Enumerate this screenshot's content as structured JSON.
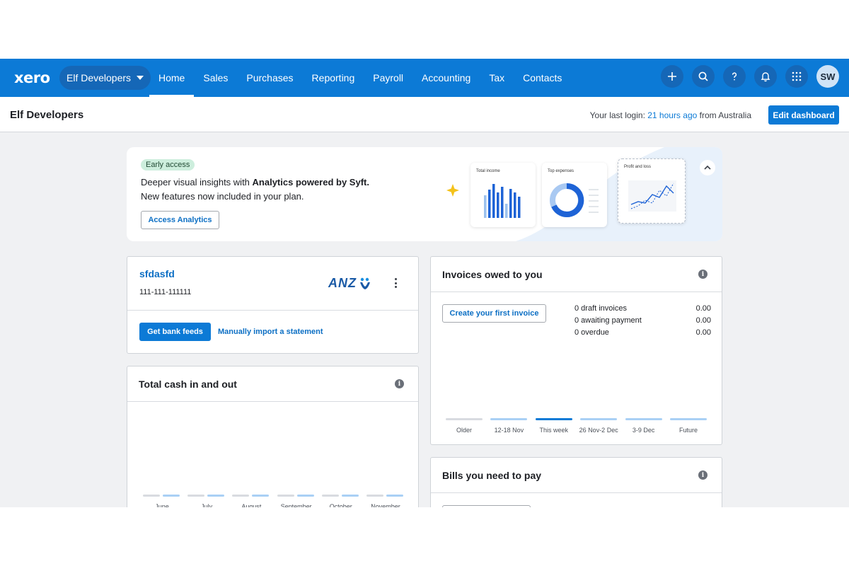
{
  "brand": {
    "logo": "xero",
    "primary": "#0c7ad6",
    "pill": "#1567b7"
  },
  "topnav": {
    "org_switcher": "Elf Developers",
    "links": [
      {
        "label": "Home",
        "active": true
      },
      {
        "label": "Sales"
      },
      {
        "label": "Purchases"
      },
      {
        "label": "Reporting"
      },
      {
        "label": "Payroll"
      },
      {
        "label": "Accounting"
      },
      {
        "label": "Tax"
      },
      {
        "label": "Contacts"
      }
    ],
    "icons": [
      "plus-icon",
      "search-icon",
      "help-icon",
      "bell-icon",
      "apps-grid-icon"
    ],
    "avatar_initials": "SW"
  },
  "subheader": {
    "org_title": "Elf Developers",
    "last_login_prefix": "Your last login: ",
    "last_login_time": "21 hours ago",
    "last_login_suffix": " from Australia",
    "edit_button": "Edit dashboard"
  },
  "banner": {
    "badge": "Early access",
    "line1_prefix": "Deeper visual insights with ",
    "line1_bold": "Analytics powered by Syft.",
    "line2": "New features now included in your plan.",
    "button": "Access Analytics",
    "mini_cards": [
      "Total income",
      "Top expenses",
      "Profit and loss"
    ]
  },
  "bank_panel": {
    "name": "sfdasfd",
    "account_number": "111-111-111111",
    "bank_logo": "ANZ",
    "feeds_button": "Get bank feeds",
    "import_link": "Manually import a statement"
  },
  "cash_panel": {
    "title": "Total cash in and out",
    "months": [
      "June",
      "July",
      "August",
      "September",
      "October",
      "November"
    ]
  },
  "invoices_panel": {
    "title": "Invoices owed to you",
    "create_button": "Create your first invoice",
    "summary": [
      {
        "label": "0 draft invoices",
        "value": "0.00"
      },
      {
        "label": "0 awaiting payment",
        "value": "0.00"
      },
      {
        "label": "0 overdue",
        "value": "0.00"
      }
    ],
    "periods": [
      "Older",
      "12-18 Nov",
      "This week",
      "26 Nov-2 Dec",
      "3-9 Dec",
      "Future"
    ]
  },
  "bills_panel": {
    "title": "Bills you need to pay"
  }
}
